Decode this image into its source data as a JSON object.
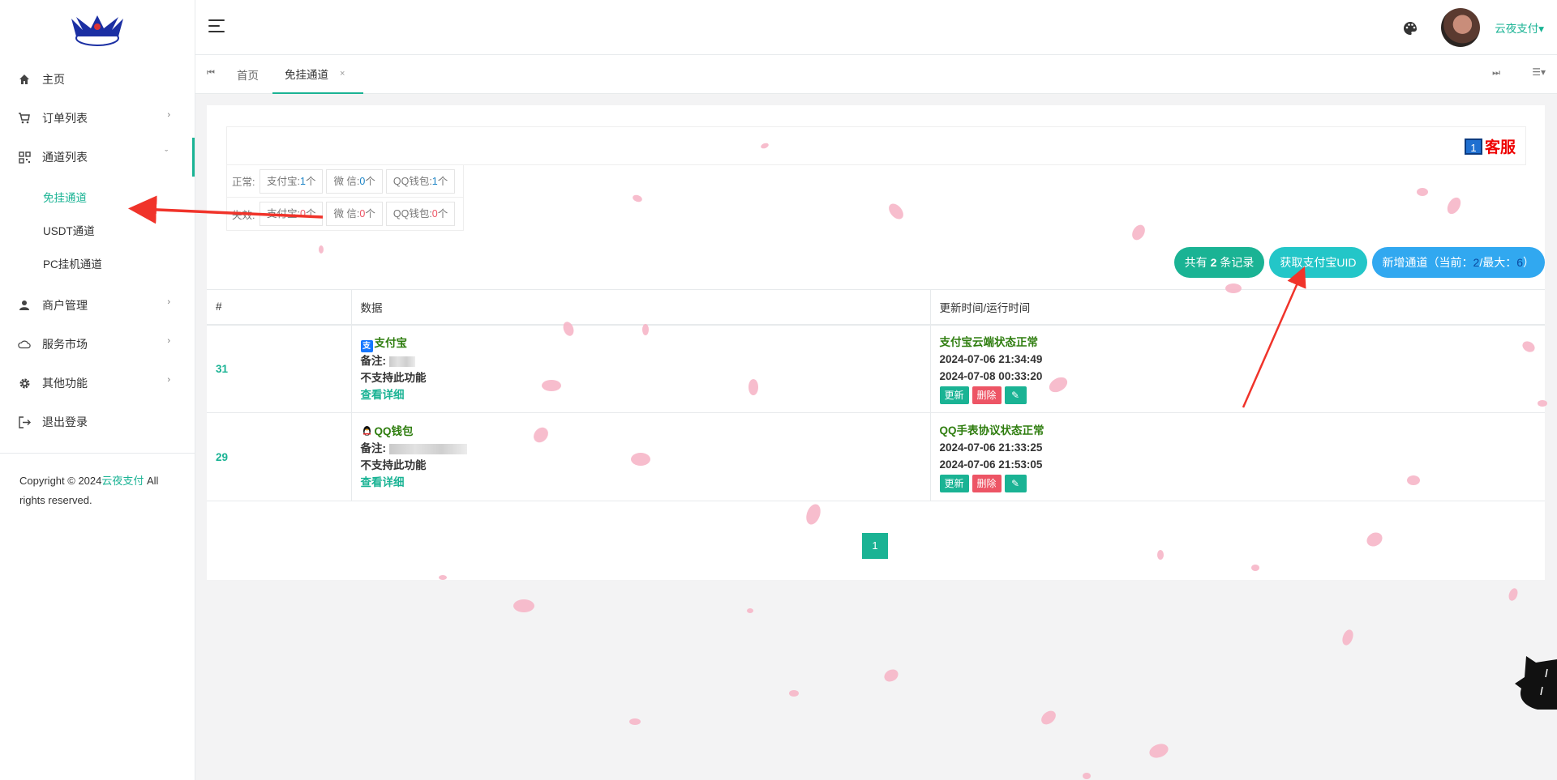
{
  "sidebar": {
    "items": [
      {
        "label": "主页",
        "icon": "home-icon"
      },
      {
        "label": "订单列表",
        "icon": "cart-icon"
      },
      {
        "label": "通道列表",
        "icon": "qrcode-icon"
      },
      {
        "label": "商户管理",
        "icon": "user-icon"
      },
      {
        "label": "服务市场",
        "icon": "cloud-icon"
      },
      {
        "label": "其他功能",
        "icon": "gear-icon"
      },
      {
        "label": "退出登录",
        "icon": "logout-icon"
      }
    ],
    "sub_items": [
      "免挂通道",
      "USDT通道",
      "PC挂机通道"
    ],
    "copyright_pre": "Copyright © 2024",
    "copyright_brand": "云夜支付",
    "copyright_post": " All rights reserved."
  },
  "header": {
    "user_name": "云夜支付▾"
  },
  "tabs": {
    "home": "首页",
    "current": "免挂通道",
    "close": "×"
  },
  "kefu": {
    "num": "1",
    "label": "客服"
  },
  "stats": {
    "normal_label": "正常:",
    "invalid_label": "失效:",
    "normal": [
      {
        "pre": "支付宝:",
        "val": "1",
        "suf": "个"
      },
      {
        "pre": "微 信:",
        "val": "0",
        "suf": "个"
      },
      {
        "pre": "QQ钱包:",
        "val": "1",
        "suf": "个"
      }
    ],
    "invalid": [
      {
        "pre": "支付宝:",
        "val": "0",
        "suf": "个"
      },
      {
        "pre": "微 信:",
        "val": "0",
        "suf": "个"
      },
      {
        "pre": "QQ钱包:",
        "val": "0",
        "suf": "个"
      }
    ]
  },
  "buttons": {
    "records_pre": "共有",
    "records_count": "2",
    "records_suf": "条记录",
    "get_uid": "获取支付宝UID",
    "add_pre": "新增通道（当前：",
    "add_current": "2",
    "add_mid": "/最大：",
    "add_max": "6",
    "add_suf": "）"
  },
  "table": {
    "headers": [
      "#",
      "数据",
      "更新时间/运行时间"
    ],
    "rows": [
      {
        "id": "31",
        "type": "支付宝",
        "note_label": "备注:",
        "support": "不支持此功能",
        "detail": "查看详细",
        "status": "支付宝云端状态正常",
        "updated": "2024-07-06 21:34:49",
        "run": "2024-07-08 00:33:20",
        "update_btn": "更新",
        "delete_btn": "删除"
      },
      {
        "id": "29",
        "type": "QQ钱包",
        "note_label": "备注:",
        "support": "不支持此功能",
        "detail": "查看详细",
        "status": "QQ手表协议状态正常",
        "updated": "2024-07-06 21:33:25",
        "run": "2024-07-06 21:53:05",
        "update_btn": "更新",
        "delete_btn": "删除"
      }
    ]
  },
  "pagination": {
    "current": "1"
  },
  "colors": {
    "accent": "#1ab394",
    "danger": "#ed5565",
    "annotation_arrow": "#f0332a",
    "petal": "#f7b6c8"
  }
}
